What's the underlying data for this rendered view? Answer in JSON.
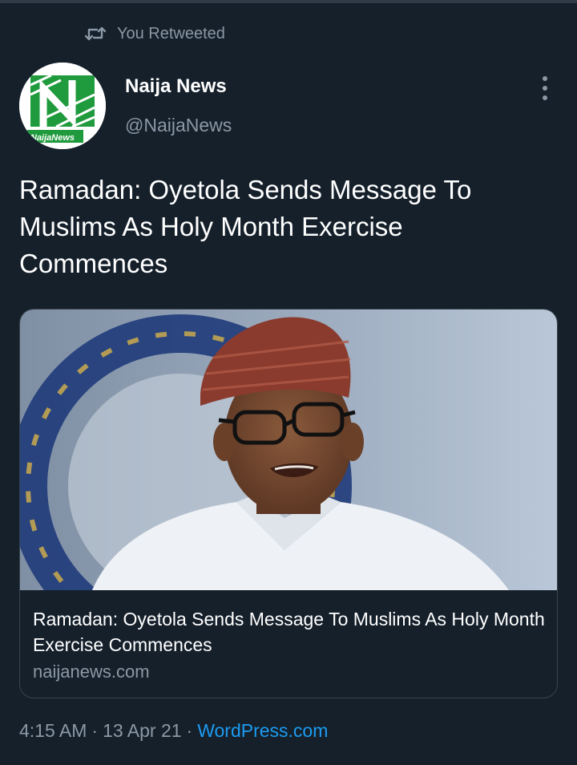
{
  "retweet": {
    "label": "You Retweeted"
  },
  "author": {
    "name": "Naija News",
    "handle": "@NaijaNews",
    "avatar_text": "NaijaNews"
  },
  "tweet": {
    "text": "Ramadan: Oyetola Sends Message To Muslims As Holy Month Exercise Commences"
  },
  "card": {
    "title": "Ramadan: Oyetola Sends Message To Muslims As Holy Month Exercise Commences",
    "domain": "naijanews.com"
  },
  "meta": {
    "time": "4:15 AM",
    "sep1": "·",
    "date": "13 Apr 21",
    "sep2": "·",
    "source": "WordPress.com"
  },
  "colors": {
    "background": "#15202b",
    "secondary_text": "#8b98a5",
    "link": "#1d9bf0",
    "brand_green": "#1f9a3c"
  },
  "icons": {
    "retweet": "retweet-icon",
    "more": "more-vertical-icon"
  }
}
